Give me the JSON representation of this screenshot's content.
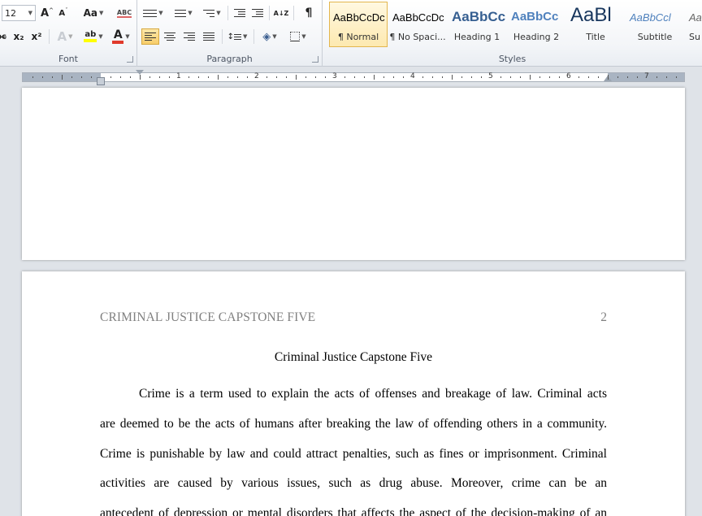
{
  "ribbon": {
    "font": {
      "label": "Font",
      "size_value": "12",
      "grow_label": "A",
      "shrink_label": "A",
      "case_label": "Aa",
      "clear_label": "ABC",
      "strike_label": "abc",
      "subscript_label": "x₂",
      "superscript_label": "x²",
      "effects_label": "A",
      "highlight_label": "ab",
      "color_label": "A",
      "highlight_color": "#ffff00",
      "font_color": "#e03a2b"
    },
    "paragraph": {
      "label": "Paragraph",
      "sort_label": "A↓Z",
      "pilcrow_label": "¶"
    },
    "styles": {
      "label": "Styles",
      "items": [
        {
          "sample": "AaBbCcDc",
          "name": "¶ Normal"
        },
        {
          "sample": "AaBbCcDc",
          "name": "¶ No Spaci..."
        },
        {
          "sample": "AaBbCc",
          "name": "Heading 1"
        },
        {
          "sample": "AaBbCc",
          "name": "Heading 2"
        },
        {
          "sample": "AaBl",
          "name": "Title"
        },
        {
          "sample": "AaBbCcl",
          "name": "Subtitle"
        },
        {
          "sample": "AaBl",
          "name": "Subt"
        }
      ]
    }
  },
  "ruler": {
    "numbers": [
      "1",
      "2",
      "3",
      "4",
      "5",
      "6",
      "7"
    ]
  },
  "document": {
    "running_head": "CRIMINAL JUSTICE CAPSTONE FIVE",
    "page_number": "2",
    "title": "Criminal  Justice Capstone Five",
    "lines": [
      "Crime is a term used to explain the acts of offenses and breakage of law.   Criminal acts",
      "are deemed to be the acts of humans after breaking the law of offending others in a community.",
      "Crime is punishable by law and could attract penalties, such as fines or imprisonment.   Criminal",
      "activities are caused by various issues, such as drug abuse.   Moreover, crime can be an",
      "antecedent of depression or mental disorders that affects the aspect of the decision-making of an"
    ]
  },
  "colors": {
    "selected_style_border": "#e3b64e",
    "header_text": "#808080"
  }
}
